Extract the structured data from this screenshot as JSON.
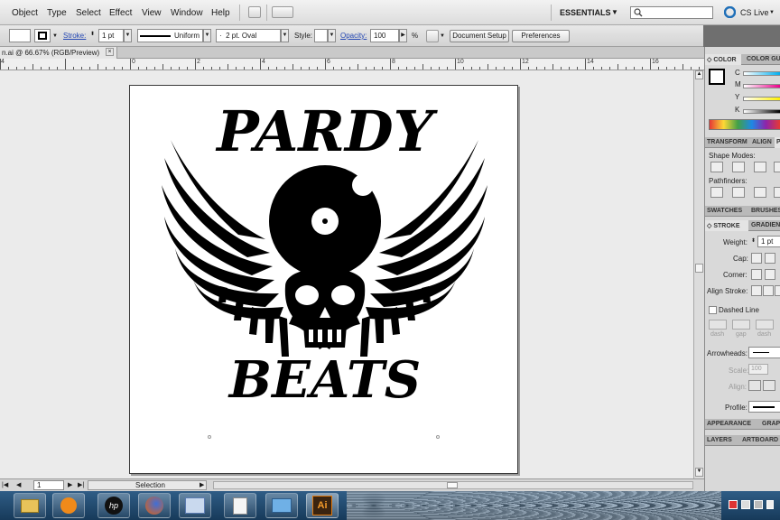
{
  "menu": [
    "Object",
    "Type",
    "Select",
    "Effect",
    "View",
    "Window",
    "Help"
  ],
  "workspace": "ESSENTIALS",
  "search": {
    "placeholder": ""
  },
  "cs_live": "CS Live",
  "control": {
    "stroke_label": "Stroke:",
    "stroke_weight": "1 pt",
    "profile": "Uniform",
    "brush": "2 pt. Oval",
    "style_label": "Style:",
    "opacity_label": "Opacity:",
    "opacity_value": "100",
    "opacity_unit": "%",
    "doc_setup": "Document Setup",
    "preferences": "Preferences"
  },
  "document_tab": {
    "title": "n.ai @ 66.67% (RGB/Preview)",
    "close": "×"
  },
  "ruler": [
    "4",
    "0",
    "2",
    "4",
    "6",
    "8",
    "10",
    "12",
    "14",
    "16"
  ],
  "artwork": {
    "top_text": "PARDY",
    "bottom_text": "BEATS"
  },
  "status": {
    "zoom": "1",
    "tool": "Selection"
  },
  "panels": {
    "color_tabs": [
      "COLOR",
      "COLOR GU"
    ],
    "color_channels": [
      "C",
      "M",
      "Y",
      "K"
    ],
    "transform_tabs": [
      "TRANSFORM",
      "ALIGN",
      "P"
    ],
    "shape_modes": "Shape Modes:",
    "pathfinders": "Pathfinders:",
    "swatches_tabs": [
      "SWATCHES",
      "BRUSHES"
    ],
    "stroke_tabs": [
      "STROKE",
      "GRADIEN"
    ],
    "weight_label": "Weight:",
    "weight_value": "1 pt",
    "cap_label": "Cap:",
    "corner_label": "Corner:",
    "align_stroke_label": "Align Stroke:",
    "dashed_line": "Dashed Line",
    "dash_labels": [
      "dash",
      "gap",
      "dash"
    ],
    "arrowheads_label": "Arrowheads:",
    "scale_label": "Scale:",
    "scale_value": "100",
    "align_label": "Align:",
    "profile_label": "Profile:",
    "appearance_tabs": [
      "APPEARANCE",
      "GRAP"
    ],
    "layers_tabs": [
      "LAYERS",
      "ARTBOARD"
    ]
  },
  "colors": {
    "accent_link": "#2447b3",
    "illustrator_orange": "#e07a10",
    "taskbar": "#173a5a"
  },
  "taskbar_icons": [
    "file-explorer-icon",
    "media-player-icon",
    "hp-icon",
    "firefox-icon",
    "paint-icon",
    "notepad-icon",
    "remote-desktop-icon",
    "illustrator-icon"
  ],
  "illustrator_label": "Ai"
}
